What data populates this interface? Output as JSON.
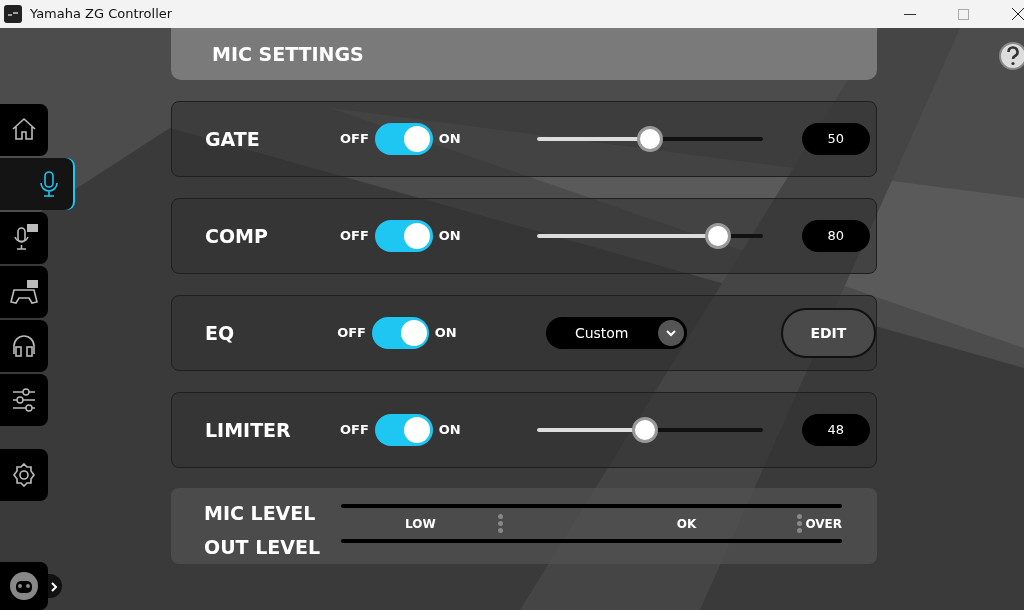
{
  "window": {
    "title": "Yamaha ZG Controller"
  },
  "sidebar": {
    "items": [
      {
        "kind": "home",
        "selected": false
      },
      {
        "kind": "mic",
        "selected": true
      },
      {
        "kind": "mic-fx",
        "selected": false
      },
      {
        "kind": "game-fx",
        "selected": false
      },
      {
        "kind": "headphones",
        "selected": false
      },
      {
        "kind": "mixer",
        "selected": false
      },
      {
        "kind": "settings",
        "selected": false
      }
    ]
  },
  "header": {
    "title": "MIC SETTINGS"
  },
  "settings": [
    {
      "kind": "slider",
      "name": "GATE",
      "off_label": "OFF",
      "on_label": "ON",
      "on": true,
      "level": 0.5,
      "reading": "50"
    },
    {
      "kind": "slider",
      "name": "COMP",
      "off_label": "OFF",
      "on_label": "ON",
      "on": true,
      "level": 0.8,
      "reading": "80"
    },
    {
      "kind": "eq",
      "name": "EQ",
      "off_label": "OFF",
      "on_label": "ON",
      "on": true,
      "preset": "Custom",
      "button": "EDIT"
    },
    {
      "kind": "slider",
      "name": "LIMITER",
      "off_label": "OFF",
      "on_label": "ON",
      "on": true,
      "level": 0.48,
      "reading": "48"
    }
  ],
  "meters": {
    "labels": [
      "MIC LEVEL",
      "OUT LEVEL"
    ],
    "scale": [
      "LOW",
      "OK",
      "OVER"
    ]
  }
}
